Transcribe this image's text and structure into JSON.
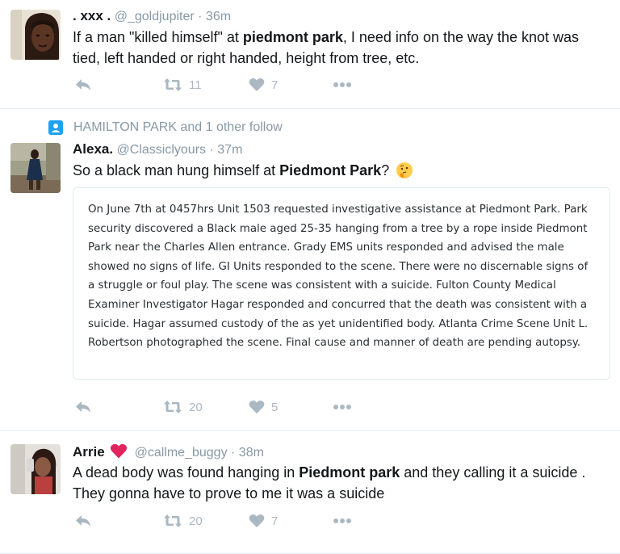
{
  "tweets": [
    {
      "display_name": ". xxx .",
      "handle": "@_goldjupiter",
      "time": "36m",
      "text_parts": [
        {
          "t": "If a man \"killed himself\" at ",
          "b": false
        },
        {
          "t": "piedmont park",
          "b": true
        },
        {
          "t": ", I need info on the way the knot was tied, left handed or right handed, height from tree, etc.",
          "b": false
        }
      ],
      "retweets": "11",
      "likes": "7"
    },
    {
      "social_context": "HAMILTON PARK and 1 other follow",
      "display_name": "Alexa.",
      "handle": "@Classiclyours",
      "time": "37m",
      "text_parts": [
        {
          "t": "So a black man hung himself at ",
          "b": false
        },
        {
          "t": "Piedmont Park",
          "b": true
        },
        {
          "t": "?",
          "b": false
        }
      ],
      "emoji": "thinking-face-emoji",
      "quote": "On June 7th at 0457hrs Unit 1503 requested investigative assistance at Piedmont Park.  Park security discovered a Black male aged 25-35 hanging from a tree by a rope inside Piedmont Park near the Charles Allen entrance.  Grady EMS units responded and advised the male showed no signs of life.  GI Units responded to the scene.  There were no discernable signs of a struggle or foul play.  The scene was consistent with a suicide.  Fulton County  Medical Examiner Investigator Hagar responded and concurred that the death was consistent with a suicide.  Hagar assumed custody of the as yet unidentified body.  Atlanta Crime Scene Unit L. Robertson photographed the scene.  Final cause and manner of death are pending autopsy.",
      "retweets": "20",
      "likes": "5"
    },
    {
      "display_name": "Arrie",
      "handle": "@callme_buggy",
      "time": "38m",
      "text_parts": [
        {
          "t": "A dead body was found hanging in ",
          "b": false
        },
        {
          "t": "Piedmont park",
          "b": true
        },
        {
          "t": " and they calling it a suicide . They gonna have to prove to me it was a suicide",
          "b": false
        }
      ],
      "retweets": "20",
      "likes": "7"
    }
  ],
  "separator": "·",
  "colors": {
    "name": "#14171a",
    "muted": "#8899a6",
    "action": "#aab8c2",
    "border": "#e1e8ed",
    "accent": "#1da1f2",
    "heart": "#e0245e"
  },
  "icons": [
    "reply-icon",
    "retweet-icon",
    "like-icon",
    "more-icon",
    "follow-context-icon",
    "heart-emoji-icon"
  ]
}
